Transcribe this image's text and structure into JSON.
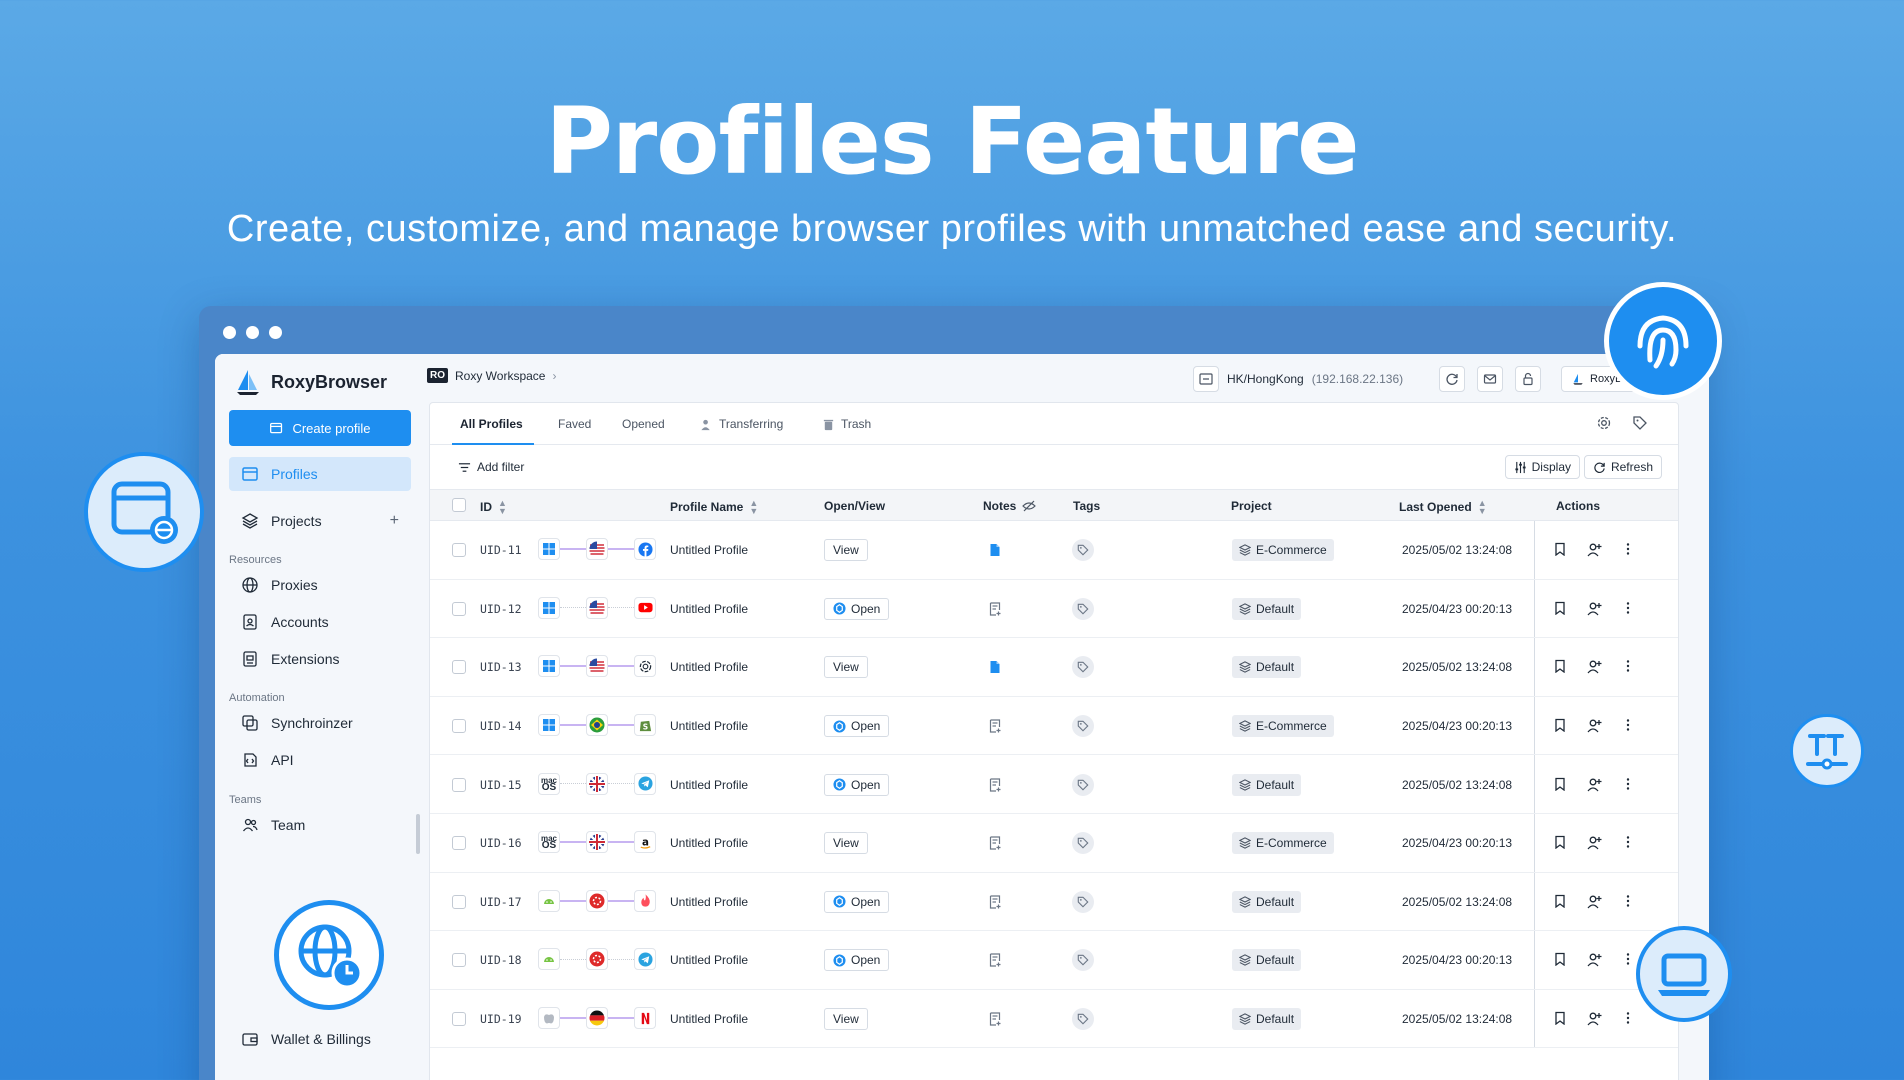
{
  "hero": {
    "title": "Profiles Feature",
    "subtitle": "Create, customize, and manage browser profiles with unmatched ease and security."
  },
  "sidebar": {
    "brand": "RoxyBrowser",
    "create_button": "Create profile",
    "items": [
      {
        "label": "Profiles",
        "icon": "window-icon",
        "active": true
      },
      {
        "label": "Projects",
        "icon": "layers-icon"
      }
    ],
    "sections": [
      {
        "title": "Resources",
        "items": [
          "Proxies",
          "Accounts",
          "Extensions"
        ]
      },
      {
        "title": "Automation",
        "items": [
          "Synchroinzer",
          "API"
        ]
      },
      {
        "title": "Teams",
        "items": [
          "Team"
        ]
      }
    ],
    "wallet": "Wallet & Billings"
  },
  "topbar": {
    "workspace_badge": "RO",
    "workspace": "Roxy Workspace",
    "proxy_label": "HK/HongKong",
    "proxy_ip": "(192.168.22.136)",
    "user": "RoxyBr..."
  },
  "tabs": [
    "All Profiles",
    "Faved",
    "Opened",
    "Transferring",
    "Trash"
  ],
  "filters": {
    "add_filter": "Add filter",
    "display": "Display",
    "refresh": "Refresh"
  },
  "columns": {
    "id": "ID",
    "name": "Profile Name",
    "open": "Open/View",
    "notes": "Notes",
    "tags": "Tags",
    "project": "Project",
    "last_opened": "Last Opened",
    "actions": "Actions"
  },
  "rows": [
    {
      "id": "UID-11",
      "name": "Untitled Profile",
      "btn": "View",
      "project": "E-Commerce",
      "last": "2025/05/02 13:24:08",
      "os": "windows",
      "flag": "us",
      "site": "facebook",
      "note": "filled"
    },
    {
      "id": "UID-12",
      "name": "Untitled Profile",
      "btn": "Open",
      "project": "Default",
      "last": "2025/04/23 00:20:13",
      "os": "windows",
      "flag": "us",
      "site": "youtube",
      "note": "empty"
    },
    {
      "id": "UID-13",
      "name": "Untitled Profile",
      "btn": "View",
      "project": "Default",
      "last": "2025/05/02 13:24:08",
      "os": "windows",
      "flag": "us",
      "site": "openai",
      "note": "filled"
    },
    {
      "id": "UID-14",
      "name": "Untitled Profile",
      "btn": "Open",
      "project": "E-Commerce",
      "last": "2025/04/23 00:20:13",
      "os": "windows",
      "flag": "br",
      "site": "shopify",
      "note": "empty"
    },
    {
      "id": "UID-15",
      "name": "Untitled Profile",
      "btn": "Open",
      "project": "Default",
      "last": "2025/05/02 13:24:08",
      "os": "macos",
      "flag": "uk",
      "site": "telegram",
      "note": "empty"
    },
    {
      "id": "UID-16",
      "name": "Untitled Profile",
      "btn": "View",
      "project": "E-Commerce",
      "last": "2025/04/23 00:20:13",
      "os": "macos",
      "flag": "uk",
      "site": "amazon",
      "note": "empty"
    },
    {
      "id": "UID-17",
      "name": "Untitled Profile",
      "btn": "Open",
      "project": "Default",
      "last": "2025/05/02 13:24:08",
      "os": "android",
      "flag": "hk",
      "site": "tinder",
      "note": "empty"
    },
    {
      "id": "UID-18",
      "name": "Untitled Profile",
      "btn": "Open",
      "project": "Default",
      "last": "2025/04/23 00:20:13",
      "os": "android",
      "flag": "hk",
      "site": "telegram",
      "note": "empty"
    },
    {
      "id": "UID-19",
      "name": "Untitled Profile",
      "btn": "View",
      "project": "Default",
      "last": "2025/05/02 13:24:08",
      "os": "apple",
      "flag": "de",
      "site": "netflix",
      "note": "empty"
    }
  ],
  "colors": {
    "accent": "#1e8ef0",
    "background_top": "#5ba9e6",
    "background_bottom": "#2f86db"
  }
}
